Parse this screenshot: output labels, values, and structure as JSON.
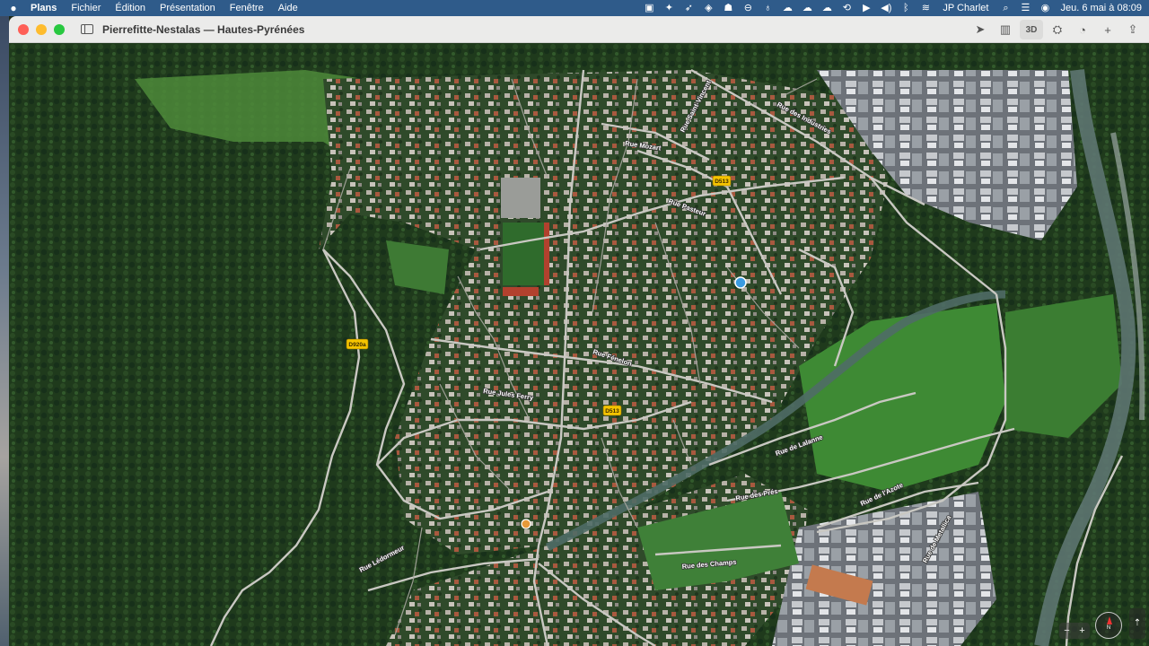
{
  "menubar": {
    "app_name": "Plans",
    "menus": [
      "Fichier",
      "Édition",
      "Présentation",
      "Fenêtre",
      "Aide"
    ],
    "user": "JP Charlet",
    "datetime": "Jeu. 6 mai à 08:09"
  },
  "window": {
    "title": "Pierrefitte-Nestalas — Hautes-Pyrénées",
    "mode_3d_label": "3D"
  },
  "map": {
    "streets": [
      "Rue des Industries",
      "Rue Saint-Vincent",
      "Rue Mozart",
      "Rue Pasteur",
      "Rue Fénelon",
      "Rue Jules Ferry",
      "Rue de Lalanne",
      "Rue des Prés",
      "Rue de l'Azote",
      "Rue de Metallica",
      "Rue des Champs",
      "Rue Lédormeur"
    ],
    "road_shields": [
      "D513",
      "D920a",
      "D513"
    ],
    "compass_label": "N"
  }
}
